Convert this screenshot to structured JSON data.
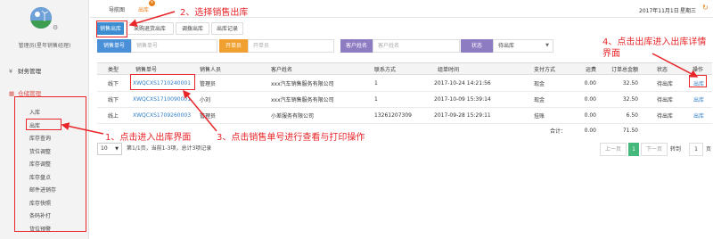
{
  "sidebar": {
    "user_name": "管理员(星年销售经理)",
    "menu_finance": "财务管理",
    "menu_stock": "仓储管理",
    "items": [
      "入库",
      "出库",
      "库存查询",
      "货位调整",
      "库存调整",
      "库存盘点",
      "邮件进销存",
      "库存快照",
      "条码补打",
      "货位预警"
    ]
  },
  "topbar": {
    "tabs": [
      "导航图",
      "出库"
    ],
    "date": "2017年11月1日",
    "weekday": "星期三"
  },
  "subtabs": [
    "销售出库",
    "采购退货出库",
    "调拨出库",
    "出库记录"
  ],
  "filters": {
    "sales_no_label": "销售单号",
    "sales_no_placeholder": "销售单号",
    "issuer_label": "开单员",
    "issuer_placeholder": "开单员",
    "customer_label": "客户姓名",
    "customer_placeholder": "客户姓名",
    "status_label": "状态",
    "status_value": "待出库"
  },
  "table": {
    "headers": [
      "类型",
      "销售单号",
      "销售人员",
      "客户姓名",
      "联系方式",
      "组单时间",
      "支付方式",
      "运费",
      "订单总金额",
      "状态",
      "操作"
    ],
    "rows": [
      [
        "线下",
        "XWQCXS1710240001",
        "管理员",
        "xxx汽车销售服务有限公司",
        "1",
        "2017-10-24 14:21:56",
        "现金",
        "0.00",
        "32.50",
        "待出库",
        "出库"
      ],
      [
        "线下",
        "XWQCXS1710090001",
        "小刘",
        "xxx汽车销售服务有限公司",
        "1",
        "2017-10-09 15:39:14",
        "现金",
        "0.00",
        "32.50",
        "待出库",
        "出库"
      ],
      [
        "线上",
        "XWQCXS1709260003",
        "管理员",
        "小差服务有限公司",
        "13261207309",
        "2017-09-28 15:29:11",
        "挂账",
        "0.00",
        "6.50",
        "待出库",
        "出库"
      ]
    ],
    "total_label": "合计：",
    "total_freight": "0.00",
    "total_amount": "71.50"
  },
  "pager": {
    "page_size": "10",
    "info": "第1/1页，当前1-3项，总计3项记录",
    "prev": "上一页",
    "current": "1",
    "next": "下一页",
    "jump_label": "转到",
    "jump_value": "1",
    "page_unit": "页"
  },
  "annotations": {
    "step1": "1、点击进入出库界面",
    "step2": "2、选择销售出库",
    "step3": "3、点击销售单号进行查看与打印操作",
    "step4_line1": "4、点击出库进入出库详情",
    "step4_line2": "界面"
  },
  "colors": {
    "primary_blue": "#3b8cd1",
    "filter_blue": "#4a90d9",
    "filter_orange": "#f0a030",
    "filter_purple": "#8e7cc3",
    "accent_orange": "#e57d14",
    "annotation_red": "#e8262a",
    "pager_green": "#45b97c"
  },
  "icons": [
    "avatar-logo-icon",
    "gear-icon",
    "yen-icon",
    "warehouse-icon",
    "close-icon",
    "refresh-icon",
    "chevron-down-icon"
  ]
}
